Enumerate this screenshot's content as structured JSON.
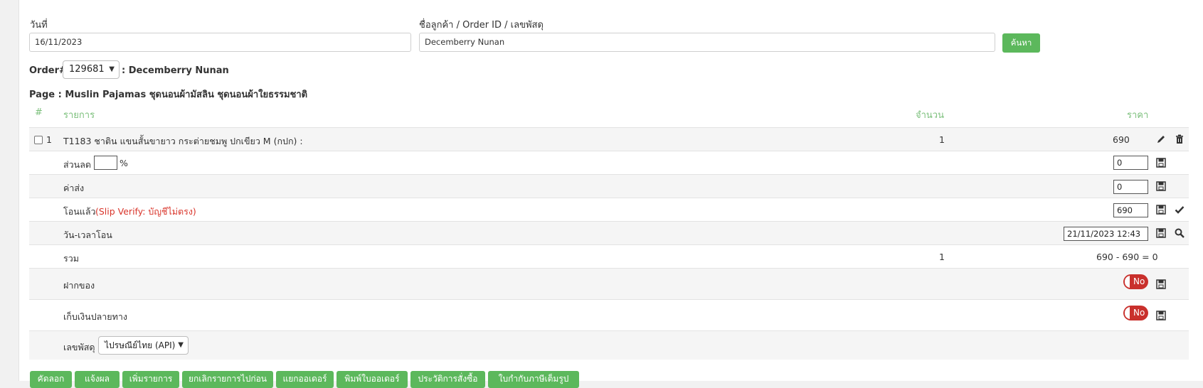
{
  "search": {
    "date_label": "วันที่",
    "date_value": "16/11/2023",
    "customer_label": "ชื่อลูกค้า / Order ID / เลขพัสดุ",
    "customer_value": "Decemberry Nunan",
    "search_button": "ค้นหา"
  },
  "order": {
    "prefix": "Order#",
    "selected_id": "129681",
    "customer_suffix": ": Decemberry Nunan",
    "page_text": "Page : Muslin Pajamas ชุดนอนผ้ามัสลิน ชุดนอนผ้าใยธรรมชาติ"
  },
  "table": {
    "headers": {
      "num": "#",
      "item": "รายการ",
      "qty": "จำนวน",
      "price": "ราคา"
    },
    "item": {
      "num": "1",
      "name": "T1183 ชาติน แขนสั้นขายาว กระต่ายชมพู ปกเขียว M (กปก) :",
      "qty": "1",
      "price": "690"
    },
    "discount": {
      "label": "ส่วนลด",
      "percent_value": "",
      "percent_sign": "%",
      "amount": "0"
    },
    "shipping": {
      "label": "ค่าส่ง",
      "amount": "0"
    },
    "paid": {
      "label": "โอนแล้ว",
      "note": "(Slip Verify: บัญชีไม่ตรง)",
      "amount": "690"
    },
    "transfer_time": {
      "label": "วัน-เวลาโอน",
      "value": "21/11/2023 12:43"
    },
    "total": {
      "label": "รวม",
      "qty": "1",
      "formula": "690 - 690 = 0"
    },
    "deposit": {
      "label": "ฝากของ",
      "toggle": "No"
    },
    "cod": {
      "label": "เก็บเงินปลายทาง",
      "toggle": "No"
    },
    "tracking": {
      "label": "เลขพัสดุ",
      "carrier": "ไปรษณีย์ไทย (API)"
    }
  },
  "actions": [
    "คัดลอก",
    "แจ้งผล",
    "เพิ่มรายการ",
    "ยกเลิกรายการไปก่อน",
    "แยกออเดอร์",
    "พิมพ์ใบออเดอร์",
    "ประวัติการสั่งซื้อ",
    "ใบกำกับภาษีเต็มรูป"
  ],
  "colors": {
    "accent_green": "#5cb85c",
    "header_green": "#7cc07c",
    "danger_red": "#c9302c",
    "warning_text": "#d9352b"
  }
}
